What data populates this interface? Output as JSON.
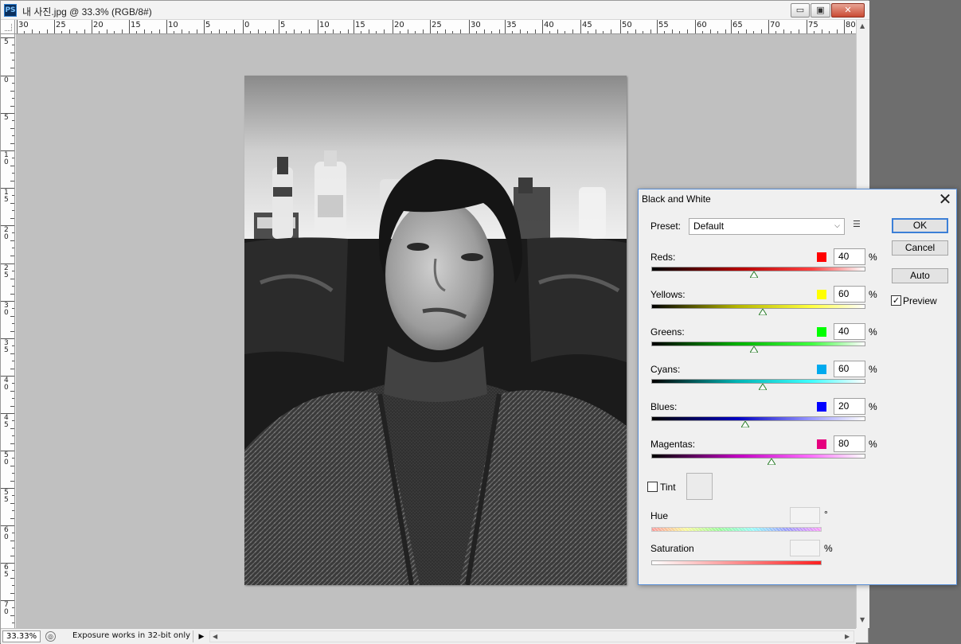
{
  "window": {
    "app_icon": "PS",
    "document_title": "내 사진.jpg @ 33.3% (RGB/8#)",
    "controls": {
      "minimize": "▭",
      "restore": "▣",
      "close": "✕"
    }
  },
  "rulers": {
    "horizontal_labels": [
      "30",
      "25",
      "20",
      "15",
      "10",
      "5",
      "0",
      "5",
      "10",
      "15",
      "20",
      "25",
      "30",
      "35",
      "40",
      "45",
      "50",
      "55",
      "60",
      "65",
      "70",
      "75",
      "80"
    ],
    "vertical_labels": [
      "5",
      "0",
      "5",
      "10",
      "15",
      "20",
      "25",
      "30",
      "35",
      "40",
      "45",
      "50",
      "55",
      "60",
      "65",
      "70"
    ]
  },
  "status_bar": {
    "zoom": "33.33%",
    "message": "Exposure works in 32-bit only",
    "arrow": "▶"
  },
  "dialog": {
    "title": "Black and White",
    "close_glyph": "✕",
    "preset_label": "Preset:",
    "preset_value": "Default",
    "buttons": {
      "ok": "OK",
      "cancel": "Cancel",
      "auto": "Auto"
    },
    "preview_label": "Preview",
    "preview_checked": true,
    "sliders": [
      {
        "label": "Reds:",
        "value": "40",
        "unit": "%",
        "swatch": "#ff0000",
        "gradient_end": "#ff4040",
        "gradient_mid": "#b10000"
      },
      {
        "label": "Yellows:",
        "value": "60",
        "unit": "%",
        "swatch": "#ffff00",
        "gradient_end": "#ffff40",
        "gradient_mid": "#b4b400"
      },
      {
        "label": "Greens:",
        "value": "40",
        "unit": "%",
        "swatch": "#00ff00",
        "gradient_end": "#40ff40",
        "gradient_mid": "#00b000"
      },
      {
        "label": "Cyans:",
        "value": "60",
        "unit": "%",
        "swatch": "#00aaee",
        "gradient_end": "#40ffff",
        "gradient_mid": "#00b4b4"
      },
      {
        "label": "Blues:",
        "value": "20",
        "unit": "%",
        "swatch": "#0000ff",
        "gradient_end": "#9a9aff",
        "gradient_mid": "#0000c0"
      },
      {
        "label": "Magentas:",
        "value": "80",
        "unit": "%",
        "swatch": "#e6007e",
        "gradient_end": "#ff70ff",
        "gradient_mid": "#c000c0"
      }
    ],
    "slider_range": {
      "min": -200,
      "max": 300
    },
    "tint_label": "Tint",
    "tint_checked": false,
    "hue_label": "Hue",
    "hue_unit": "°",
    "saturation_label": "Saturation",
    "saturation_unit": "%"
  }
}
